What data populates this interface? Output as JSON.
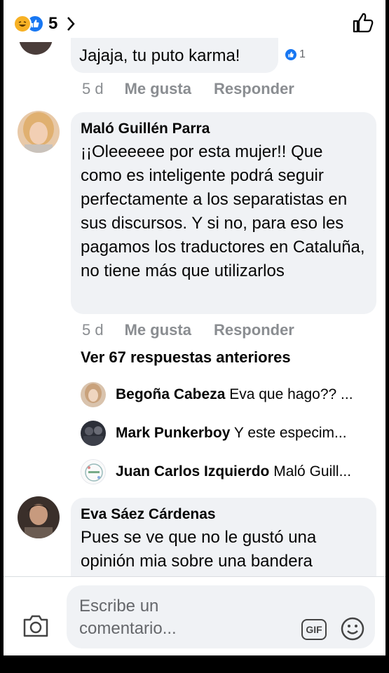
{
  "header": {
    "reaction_count": "5",
    "reactions": [
      "haha-icon",
      "like-icon"
    ]
  },
  "top_comment": {
    "text": "Jajaja, tu puto karma!",
    "reaction_count": "1",
    "timestamp": "5 d",
    "like_label": "Me gusta",
    "reply_label": "Responder"
  },
  "main_comment": {
    "author": "Maló Guillén Parra",
    "text": "¡¡Oleeeeee por esta mujer!! Que como es inteligente podrá seguir perfectamente a los separatistas en sus discursos. Y si no, para eso les pagamos los traductores en Cataluña, no tiene más que utilizarlos",
    "timestamp": "5 d",
    "like_label": "Me gusta",
    "reply_label": "Responder"
  },
  "more_replies_label": "Ver 67 respuestas anteriores",
  "replies": [
    {
      "author": "Begoña Cabeza",
      "text": "Eva que hago?? ..."
    },
    {
      "author": "Mark Punkerboy",
      "text": "Y este especim..."
    },
    {
      "author": "Juan Carlos Izquierdo",
      "text": "Maló Guill..."
    }
  ],
  "last_comment": {
    "author": "Eva Sáez Cárdenas",
    "text": "Pues se ve que no le gustó una opinión mia sobre una bandera"
  },
  "composer": {
    "placeholder": "Escribe un comentario...",
    "gif_label": "GIF"
  },
  "colors": {
    "accent": "#1877f2",
    "bubble": "#f0f2f5",
    "meta_text": "#8a8d91"
  }
}
